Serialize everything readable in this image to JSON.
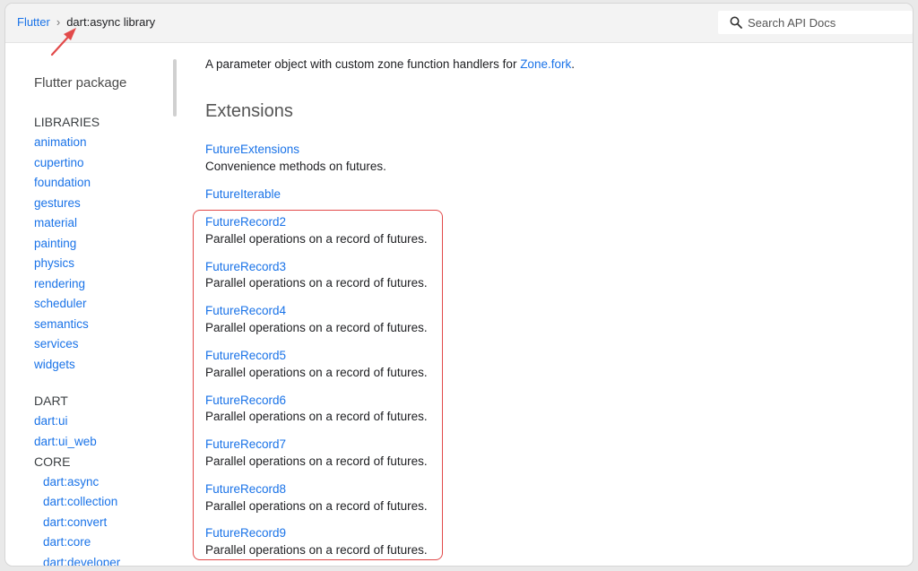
{
  "breadcrumb": {
    "root": "Flutter",
    "separator": "›",
    "current": "dart:async library"
  },
  "search": {
    "placeholder": "Search API Docs",
    "icon": "search-icon"
  },
  "sidebar": {
    "title": "Flutter package",
    "libraries_heading": "LIBRARIES",
    "libraries": [
      "animation",
      "cupertino",
      "foundation",
      "gestures",
      "material",
      "painting",
      "physics",
      "rendering",
      "scheduler",
      "semantics",
      "services",
      "widgets"
    ],
    "dart_heading": "DART",
    "dart_items": [
      "dart:ui",
      "dart:ui_web"
    ],
    "core_heading": "CORE",
    "core_items": [
      "dart:async",
      "dart:collection",
      "dart:convert",
      "dart:core",
      "dart:developer"
    ]
  },
  "main": {
    "intro_text": "A parameter object with custom zone function handlers for ",
    "intro_link": "Zone.fork",
    "intro_end": ".",
    "heading": "Extensions",
    "entries": [
      {
        "name": "FutureExtensions",
        "desc": "Convenience methods on futures."
      },
      {
        "name": "FutureIterable",
        "desc": ""
      },
      {
        "name": "FutureRecord2",
        "desc": "Parallel operations on a record of futures."
      },
      {
        "name": "FutureRecord3",
        "desc": "Parallel operations on a record of futures."
      },
      {
        "name": "FutureRecord4",
        "desc": "Parallel operations on a record of futures."
      },
      {
        "name": "FutureRecord5",
        "desc": "Parallel operations on a record of futures."
      },
      {
        "name": "FutureRecord6",
        "desc": "Parallel operations on a record of futures."
      },
      {
        "name": "FutureRecord7",
        "desc": "Parallel operations on a record of futures."
      },
      {
        "name": "FutureRecord8",
        "desc": "Parallel operations on a record of futures."
      },
      {
        "name": "FutureRecord9",
        "desc": "Parallel operations on a record of futures."
      }
    ]
  },
  "colors": {
    "link": "#1a73e8",
    "annotation": "#e24a4a"
  }
}
